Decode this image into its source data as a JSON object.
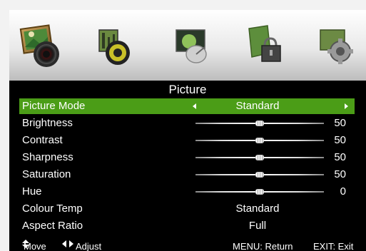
{
  "icons": [
    {
      "name": "picture-icon",
      "selected": true
    },
    {
      "name": "sound-icon",
      "selected": false
    },
    {
      "name": "channel-icon",
      "selected": false
    },
    {
      "name": "lock-icon",
      "selected": false
    },
    {
      "name": "setup-icon",
      "selected": false
    }
  ],
  "menu": {
    "title": "Picture",
    "picture_mode": {
      "label": "Picture Mode",
      "value": "Standard"
    },
    "sliders": [
      {
        "label": "Brightness",
        "value": "50",
        "level": 0.5
      },
      {
        "label": "Contrast",
        "value": "50",
        "level": 0.5
      },
      {
        "label": "Sharpness",
        "value": "50",
        "level": 0.5
      },
      {
        "label": "Saturation",
        "value": "50",
        "level": 0.5
      },
      {
        "label": "Hue",
        "value": "0",
        "level": 0.5
      }
    ],
    "colour_temp": {
      "label": "Colour Temp",
      "value": "Standard"
    },
    "aspect_ratio": {
      "label": "Aspect Ratio",
      "value": "Full"
    }
  },
  "footer": {
    "move": "Move",
    "adjust": "Adjust",
    "menu_return": "MENU: Return",
    "exit_exit": "EXIT: Exit"
  },
  "colors": {
    "selected_row": "#4b9d17",
    "background": "#000000",
    "text": "#ffffff"
  }
}
